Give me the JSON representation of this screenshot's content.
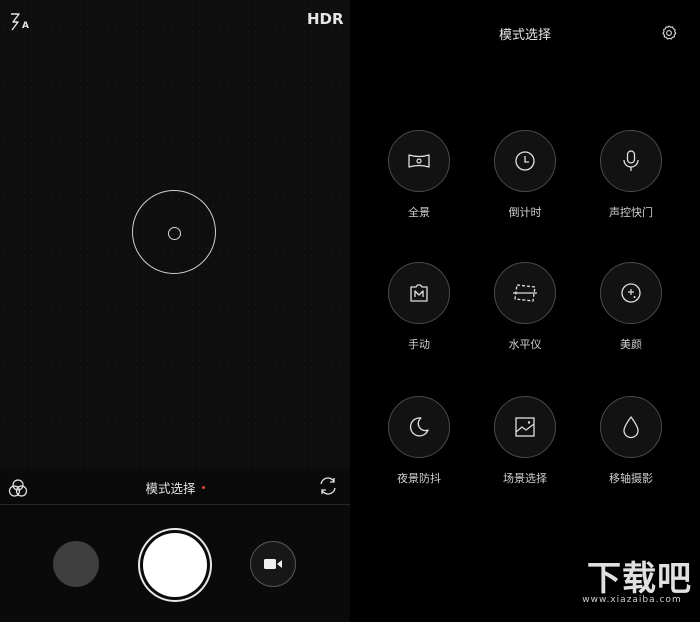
{
  "camera": {
    "flash_mode": "A",
    "hdr_label": "HDR",
    "mode_label": "模式选择",
    "icons": {
      "flash": "flash-icon",
      "filter": "filter-icon",
      "switch": "camera-switch-icon",
      "video": "video-camera-icon"
    },
    "accent_color": "#e0483a"
  },
  "panel": {
    "title": "模式选择",
    "settings_icon": "gear-icon",
    "modes": [
      {
        "label": "全景",
        "icon": "panorama-icon"
      },
      {
        "label": "倒计时",
        "icon": "clock-icon"
      },
      {
        "label": "声控快门",
        "icon": "microphone-icon"
      },
      {
        "label": "手动",
        "icon": "manual-icon"
      },
      {
        "label": "水平仪",
        "icon": "level-icon"
      },
      {
        "label": "美颜",
        "icon": "beauty-icon"
      },
      {
        "label": "夜景防抖",
        "icon": "moon-icon"
      },
      {
        "label": "场景选择",
        "icon": "scene-icon"
      },
      {
        "label": "移轴摄影",
        "icon": "droplet-icon"
      }
    ]
  },
  "watermark": {
    "main": "下载吧",
    "sub": "www.xiazaiba.com"
  }
}
